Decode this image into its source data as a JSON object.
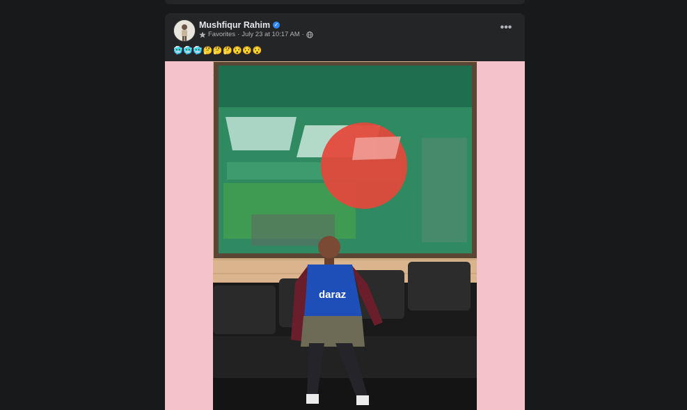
{
  "post": {
    "author": "Mushfiqur Rahim",
    "verified": true,
    "audience_label": "Favorites",
    "timestamp": "July 23 at 10:17 AM",
    "separator": "·",
    "privacy_icon": "globe-icon",
    "audience_icon": "star-icon",
    "more_label": "•••",
    "caption": "🥶🥶🥶🤔🤔🤔😯😯😯",
    "photo_bg": "#f4c2ca"
  },
  "colors": {
    "feed_bg": "#18191a",
    "card_bg": "#242526",
    "primary_text": "#e4e6eb",
    "secondary_text": "#b0b3b8",
    "verified_blue": "#2d88ff"
  }
}
